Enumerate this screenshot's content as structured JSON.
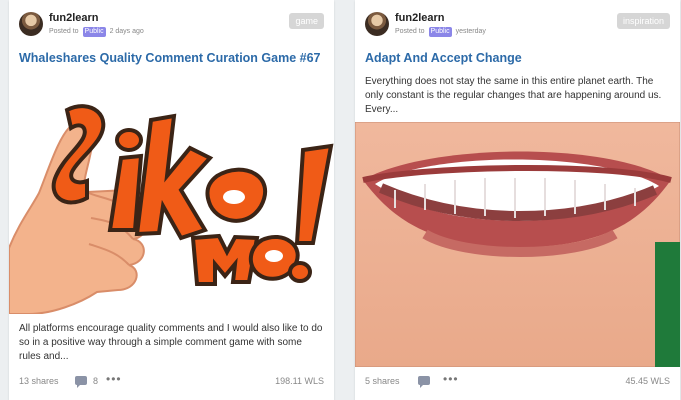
{
  "cards": [
    {
      "author": "fun2learn",
      "meta_prefix": "Posted to",
      "visibility": "Public",
      "time": "2 days ago",
      "tag": "game",
      "title": "Whaleshares Quality Comment Curation Game #67",
      "excerpt": "All platforms encourage quality comments and I would also like to do so in a positive way through a simple comment game with some rules and...",
      "shares": "13 shares",
      "comments": "8",
      "value": "198.11 WLS",
      "image_icon": "like-me-thumbs-up-image"
    },
    {
      "author": "fun2learn",
      "meta_prefix": "Posted to",
      "visibility": "Public",
      "time": "yesterday",
      "tag": "inspiration",
      "title": "Adapt And Accept Change",
      "excerpt": "Everything does not stay the same in this entire planet earth. The only constant is the regular changes that are happening around us. Every...",
      "shares": "5 shares",
      "comments": "",
      "value": "45.45 WLS",
      "image_icon": "smiling-mouth-image"
    }
  ],
  "icons": {
    "comment": "comment-icon",
    "more": "more-icon"
  },
  "colors": {
    "title": "#2c6aa8",
    "visibility_badge": "#8b86e8",
    "tag_bg": "#d6d6d6",
    "card_bg": "#ffffff",
    "page_bg": "#eceff1"
  }
}
